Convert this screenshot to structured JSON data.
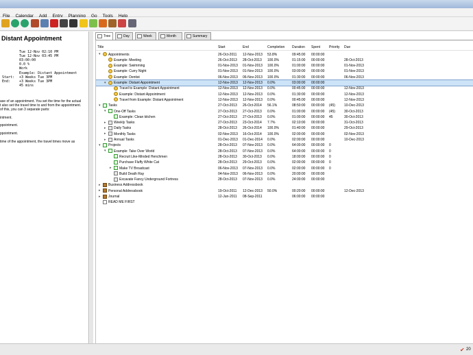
{
  "menu": [
    "File",
    "Calendar",
    "Add",
    "Entry",
    "Planning",
    "Go",
    "Tools",
    "Help"
  ],
  "toolbar": [
    "open-folder-icon",
    "undo-icon",
    "redo-icon",
    "edit-icon",
    "copy-icon",
    "delete-icon",
    "search-icon",
    "traffic-light-icon",
    "new-entry-icon",
    "new-list-icon",
    "calendar-icon",
    "journal-icon",
    "address-book-icon",
    "save-icon"
  ],
  "left": {
    "title": "Distant Appointment",
    "props": [
      "Tue 12-Nov 02:10 PM",
      "Tue 12-Nov 03:45 PM",
      "03:00:00",
      "0.0 %",
      "Work",
      "Example: Distant Appointment",
      "+3 Weeks Tue 3PM",
      "+3 Weeks Tue 3PM",
      "45 mins"
    ],
    "prop_keys": [
      "",
      "",
      "",
      "",
      "",
      "",
      "Start:",
      "End:",
      ""
    ],
    "notes": [
      "ase of an appointment. You set the time for the actual",
      "t also set the travel time to and from the appointment.",
      "of this, you can 3 separate parts:",
      "",
      "intment.",
      "",
      "ppointment.",
      "",
      "ppointment.",
      "",
      "time of the appointment, the travel times move as"
    ]
  },
  "tabs": [
    "Tree",
    "Day",
    "Week",
    "Month",
    "Summary"
  ],
  "columns": [
    "Title",
    "Start",
    "End",
    "Completion",
    "Duration",
    "Spent",
    "Priority",
    "Due"
  ],
  "rows": [
    {
      "depth": 0,
      "tog": "-",
      "icon": "clock",
      "title": "Appointments",
      "start": "26-Oct-2011",
      "end": "12-Nov-2013",
      "comp": "53.8%",
      "dur": "09:45:00",
      "spent": "00:00:00",
      "prio": "",
      "due": ""
    },
    {
      "depth": 1,
      "tog": "",
      "icon": "clock",
      "title": "Example: Meeting",
      "start": "26-Oct-2013",
      "end": "28-Oct-2013",
      "comp": "100.0%",
      "dur": "01:15:00",
      "spent": "00:00:00",
      "prio": "",
      "due": "28-Oct-2013"
    },
    {
      "depth": 1,
      "tog": "",
      "icon": "clock",
      "title": "Example: Swimming",
      "start": "01-Nov-2013",
      "end": "01-Nov-2013",
      "comp": "100.0%",
      "dur": "01:00:00",
      "spent": "00:00:00",
      "prio": "",
      "due": "01-Nov-2013"
    },
    {
      "depth": 1,
      "tog": "",
      "icon": "clock",
      "title": "Example: Curry Night",
      "start": "01-Nov-2013",
      "end": "01-Nov-2013",
      "comp": "100.0%",
      "dur": "03:00:00",
      "spent": "00:00:00",
      "prio": "",
      "due": "01-Nov-2013"
    },
    {
      "depth": 1,
      "tog": "",
      "icon": "clock",
      "title": "Example: Dentist",
      "start": "06-Nov-2013",
      "end": "06-Nov-2013",
      "comp": "100.0%",
      "dur": "01:30:00",
      "spent": "00:00:00",
      "prio": "",
      "due": "06-Nov-2013"
    },
    {
      "depth": 1,
      "tog": "-",
      "icon": "clock",
      "title": "Example: Distant Appointment",
      "start": "12-Nov-2013",
      "end": "12-Nov-2013",
      "comp": "0.0%",
      "dur": "03:00:00",
      "spent": "00:00:00",
      "prio": "",
      "due": "",
      "sel": true
    },
    {
      "depth": 2,
      "tog": "",
      "icon": "clock",
      "title": "Travel to Example: Distant Appointment",
      "start": "12-Nov-2013",
      "end": "12-Nov-2013",
      "comp": "0.0%",
      "dur": "00:45:00",
      "spent": "00:00:00",
      "prio": "",
      "due": "12-Nov-2013"
    },
    {
      "depth": 2,
      "tog": "",
      "icon": "clock",
      "title": "Example: Distant Appointment",
      "start": "12-Nov-2013",
      "end": "12-Nov-2013",
      "comp": "0.0%",
      "dur": "01:30:00",
      "spent": "00:00:00",
      "prio": "",
      "due": "12-Nov-2013"
    },
    {
      "depth": 2,
      "tog": "",
      "icon": "clock",
      "title": "Travel from Example: Distant Appointment",
      "start": "12-Nov-2013",
      "end": "12-Nov-2013",
      "comp": "0.0%",
      "dur": "00:45:00",
      "spent": "00:00:00",
      "prio": "",
      "due": "12-Nov-2013"
    },
    {
      "depth": 0,
      "tog": "-",
      "icon": "box",
      "title": "Tasks",
      "start": "27-Oct-2013",
      "end": "26-Oct-2014",
      "comp": "56.1%",
      "dur": "08:50:00",
      "spent": "00:00:00",
      "prio": "(45)",
      "due": "10-Dec-2013"
    },
    {
      "depth": 1,
      "tog": "-",
      "icon": "box",
      "title": "One-Off Tasks",
      "start": "27-Oct-2013",
      "end": "27-Oct-2013",
      "comp": "0.0%",
      "dur": "01:00:00",
      "spent": "00:00:00",
      "prio": "(45)",
      "due": "30-Oct-2013"
    },
    {
      "depth": 2,
      "tog": "",
      "icon": "box",
      "title": "Example: Clean kitchen",
      "start": "27-Oct-2013",
      "end": "27-Oct-2013",
      "comp": "0.0%",
      "dur": "01:00:00",
      "spent": "00:00:00",
      "prio": "45",
      "due": "30-Oct-2013"
    },
    {
      "depth": 1,
      "tog": "+",
      "icon": "gbox",
      "title": "Weekly Tasks",
      "start": "27-Oct-2013",
      "end": "23-Oct-2014",
      "comp": "7.7%",
      "dur": "02:10:00",
      "spent": "00:00:00",
      "prio": "",
      "due": "31-Oct-2013"
    },
    {
      "depth": 1,
      "tog": "+",
      "icon": "gbox",
      "title": "Daily Tasks",
      "start": "28-Oct-2013",
      "end": "26-Oct-2014",
      "comp": "100.0%",
      "dur": "01:40:00",
      "spent": "00:00:00",
      "prio": "",
      "due": "29-Oct-2013"
    },
    {
      "depth": 1,
      "tog": "+",
      "icon": "gbox",
      "title": "Monthly Tasks",
      "start": "02-Nov-2013",
      "end": "16-Oct-2014",
      "comp": "100.0%",
      "dur": "02:00:00",
      "spent": "00:00:00",
      "prio": "",
      "due": "02-Nov-2013"
    },
    {
      "depth": 1,
      "tog": "+",
      "icon": "gbox",
      "title": "Annual Tasks",
      "start": "01-Dec-2013",
      "end": "01-Dec-2014",
      "comp": "0.0%",
      "dur": "02:00:00",
      "spent": "00:00:00",
      "prio": "",
      "due": "10-Dec-2013"
    },
    {
      "depth": 0,
      "tog": "-",
      "icon": "box",
      "title": "Projects",
      "start": "28-Oct-2013",
      "end": "07-Nov-2013",
      "comp": "0.0%",
      "dur": "64:00:00",
      "spent": "00:00:00",
      "prio": "0",
      "due": ""
    },
    {
      "depth": 1,
      "tog": "-",
      "icon": "box",
      "title": "Example: Take Over World",
      "start": "28-Oct-2013",
      "end": "07-Nov-2013",
      "comp": "0.0%",
      "dur": "64:00:00",
      "spent": "00:00:00",
      "prio": "0",
      "due": ""
    },
    {
      "depth": 2,
      "tog": "",
      "icon": "box",
      "title": "Recruit Like-Minded Henchmen",
      "start": "28-Oct-2013",
      "end": "30-Oct-2013",
      "comp": "0.0%",
      "dur": "18:00:00",
      "spent": "00:00:00",
      "prio": "0",
      "due": ""
    },
    {
      "depth": 2,
      "tog": "",
      "icon": "box",
      "title": "Purchase Fluffy White Cat",
      "start": "28-Oct-2013",
      "end": "29-Oct-2013",
      "comp": "0.0%",
      "dur": "02:00:00",
      "spent": "00:00:00",
      "prio": "0",
      "due": ""
    },
    {
      "depth": 2,
      "tog": "+",
      "icon": "box",
      "title": "Make TV Broadcast",
      "start": "06-Nov-2013",
      "end": "07-Nov-2013",
      "comp": "0.0%",
      "dur": "02:00:00",
      "spent": "00:00:00",
      "prio": "0",
      "due": ""
    },
    {
      "depth": 2,
      "tog": "",
      "icon": "gbox",
      "title": "Build Death Ray",
      "start": "04-Nov-2013",
      "end": "06-Nov-2013",
      "comp": "0.0%",
      "dur": "20:00:00",
      "spent": "00:00:00",
      "prio": "",
      "due": ""
    },
    {
      "depth": 2,
      "tog": "",
      "icon": "gbox",
      "title": "Excavate Fancy Underground Fortress",
      "start": "28-Oct-2013",
      "end": "07-Nov-2013",
      "comp": "0.0%",
      "dur": "24:00:00",
      "spent": "00:00:00",
      "prio": "",
      "due": ""
    },
    {
      "depth": 0,
      "tog": "+",
      "icon": "book",
      "title": "Business Addressbook",
      "start": "",
      "end": "",
      "comp": "",
      "dur": "",
      "spent": "",
      "prio": "",
      "due": ""
    },
    {
      "depth": 0,
      "tog": "+",
      "icon": "book",
      "title": "Personal Addressbook",
      "start": "19-Oct-2011",
      "end": "12-Dec-2013",
      "comp": "50.0%",
      "dur": "00:20:00",
      "spent": "00:00:00",
      "prio": "",
      "due": "12-Dec-2013"
    },
    {
      "depth": 0,
      "tog": "+",
      "icon": "book",
      "title": "Journal",
      "start": "12-Jun-2011",
      "end": "08-Sep-2011",
      "comp": "",
      "dur": "06:00:00",
      "spent": "00:00:00",
      "prio": "",
      "due": ""
    },
    {
      "depth": 0,
      "tog": "",
      "icon": "page",
      "title": "READ ME FIRST",
      "start": "",
      "end": "",
      "comp": "",
      "dur": "",
      "spent": "",
      "prio": "",
      "due": ""
    }
  ],
  "status": {
    "text": "20"
  }
}
